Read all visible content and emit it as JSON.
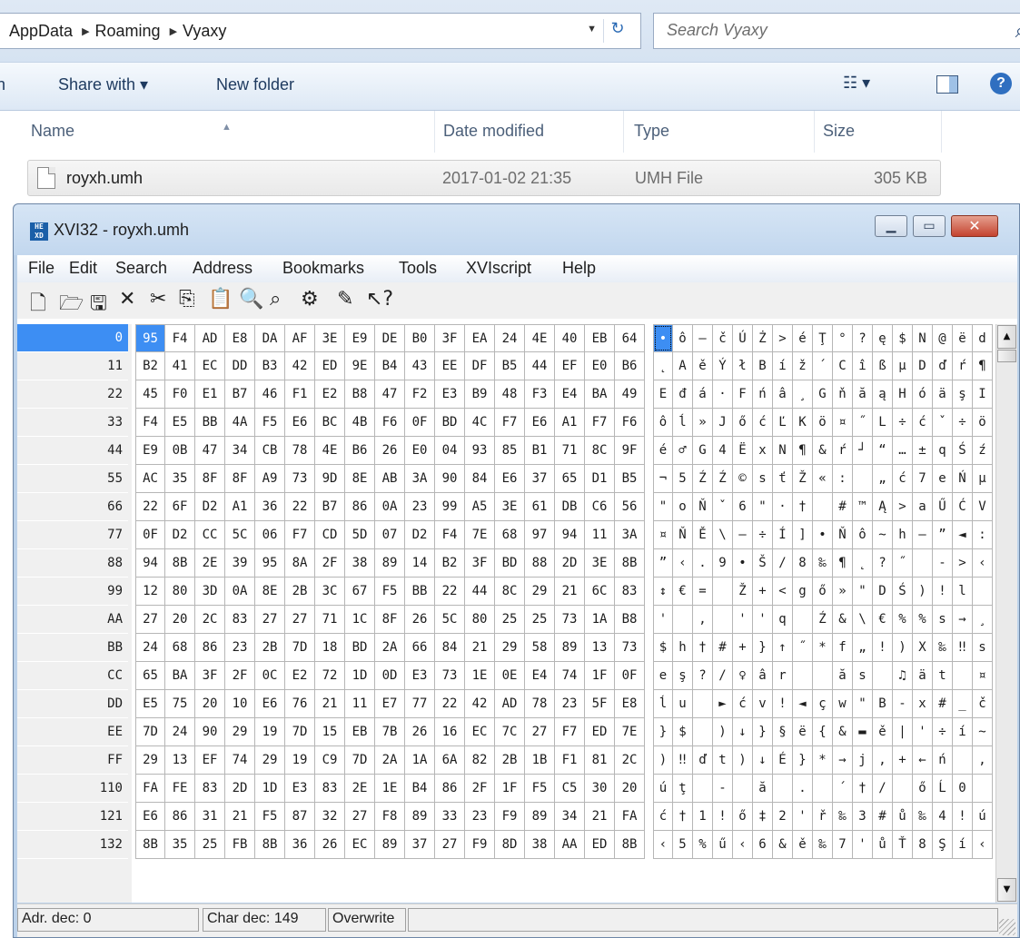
{
  "explorer": {
    "breadcrumb": [
      "AppData",
      "Roaming",
      "Vyaxy"
    ],
    "search_placeholder": "Search Vyaxy",
    "commands": {
      "left_fragment": "n",
      "share_with": "Share with ▾",
      "new_folder": "New folder"
    },
    "columns": [
      "Name",
      "Date modified",
      "Type",
      "Size"
    ],
    "file": {
      "name": "royxh.umh",
      "date": "2017-01-02 21:35",
      "type": "UMH File",
      "size": "305 KB"
    }
  },
  "xvi": {
    "title": "XVI32 - royxh.umh",
    "menu": [
      "File",
      "Edit",
      "Search",
      "Address",
      "Bookmarks",
      "Tools",
      "XVIscript",
      "Help"
    ],
    "toolbar_icons": [
      "new-file-icon",
      "open-icon",
      "save-icon",
      "close-x-icon",
      "cut-icon",
      "copy-icon",
      "paste-icon",
      "find-icon",
      "replace-icon",
      "properties-icon",
      "script-icon",
      "context-help-icon"
    ],
    "selected_row": 0,
    "rows": [
      {
        "addr": "0",
        "hex": [
          "95",
          "F4",
          "AD",
          "E8",
          "DA",
          "AF",
          "3E",
          "E9",
          "DE",
          "B0",
          "3F",
          "EA",
          "24",
          "4E",
          "40",
          "EB",
          "64"
        ],
        "chars": [
          "•",
          "ô",
          "–",
          "č",
          "Ú",
          "Ż",
          ">",
          "é",
          "Ţ",
          "°",
          "?",
          "ę",
          "$",
          "N",
          "@",
          "ë",
          "d"
        ]
      },
      {
        "addr": "11",
        "hex": [
          "B2",
          "41",
          "EC",
          "DD",
          "B3",
          "42",
          "ED",
          "9E",
          "B4",
          "43",
          "EE",
          "DF",
          "B5",
          "44",
          "EF",
          "E0",
          "B6"
        ],
        "chars": [
          "˛",
          "A",
          "ě",
          "Ý",
          "ł",
          "B",
          "í",
          "ž",
          "´",
          "C",
          "î",
          "ß",
          "µ",
          "D",
          "ď",
          "ŕ",
          "¶"
        ]
      },
      {
        "addr": "22",
        "hex": [
          "45",
          "F0",
          "E1",
          "B7",
          "46",
          "F1",
          "E2",
          "B8",
          "47",
          "F2",
          "E3",
          "B9",
          "48",
          "F3",
          "E4",
          "BA",
          "49"
        ],
        "chars": [
          "E",
          "đ",
          "á",
          "·",
          "F",
          "ń",
          "â",
          "¸",
          "G",
          "ň",
          "ă",
          "ą",
          "H",
          "ó",
          "ä",
          "ş",
          "I"
        ]
      },
      {
        "addr": "33",
        "hex": [
          "F4",
          "E5",
          "BB",
          "4A",
          "F5",
          "E6",
          "BC",
          "4B",
          "F6",
          "0F",
          "BD",
          "4C",
          "F7",
          "E6",
          "A1",
          "F7",
          "F6"
        ],
        "chars": [
          "ô",
          "ĺ",
          "»",
          "J",
          "ő",
          "ć",
          "Ľ",
          "K",
          "ö",
          "¤",
          "˝",
          "L",
          "÷",
          "ć",
          "ˇ",
          "÷",
          "ö"
        ]
      },
      {
        "addr": "44",
        "hex": [
          "E9",
          "0B",
          "47",
          "34",
          "CB",
          "78",
          "4E",
          "B6",
          "26",
          "E0",
          "04",
          "93",
          "85",
          "B1",
          "71",
          "8C",
          "9F"
        ],
        "chars": [
          "é",
          "♂",
          "G",
          "4",
          "Ë",
          "x",
          "N",
          "¶",
          "&",
          "ŕ",
          "┘",
          "“",
          "…",
          "±",
          "q",
          "Ś",
          "ź"
        ]
      },
      {
        "addr": "55",
        "hex": [
          "AC",
          "35",
          "8F",
          "8F",
          "A9",
          "73",
          "9D",
          "8E",
          "AB",
          "3A",
          "90",
          "84",
          "E6",
          "37",
          "65",
          "D1",
          "B5"
        ],
        "chars": [
          "¬",
          "5",
          "Ź",
          "Ź",
          "©",
          "s",
          "ť",
          "Ž",
          "«",
          ":",
          "",
          "„",
          "ć",
          "7",
          "e",
          "Ń",
          "µ"
        ]
      },
      {
        "addr": "66",
        "hex": [
          "22",
          "6F",
          "D2",
          "A1",
          "36",
          "22",
          "B7",
          "86",
          "0A",
          "23",
          "99",
          "A5",
          "3E",
          "61",
          "DB",
          "C6",
          "56"
        ],
        "chars": [
          "\"",
          "o",
          "Ň",
          "ˇ",
          "6",
          "\"",
          "·",
          "†",
          "",
          "#",
          "™",
          "Ą",
          ">",
          "a",
          "Ű",
          "Ć",
          "V"
        ]
      },
      {
        "addr": "77",
        "hex": [
          "0F",
          "D2",
          "CC",
          "5C",
          "06",
          "F7",
          "CD",
          "5D",
          "07",
          "D2",
          "F4",
          "7E",
          "68",
          "97",
          "94",
          "11",
          "3A"
        ],
        "chars": [
          "¤",
          "Ň",
          "Ě",
          "\\",
          "–",
          "÷",
          "Í",
          "]",
          "•",
          "Ň",
          "ô",
          "~",
          "h",
          "—",
          "”",
          "◄",
          ":"
        ]
      },
      {
        "addr": "88",
        "hex": [
          "94",
          "8B",
          "2E",
          "39",
          "95",
          "8A",
          "2F",
          "38",
          "89",
          "14",
          "B2",
          "3F",
          "BD",
          "88",
          "2D",
          "3E",
          "8B"
        ],
        "chars": [
          "”",
          "‹",
          ".",
          "9",
          "•",
          "Š",
          "/",
          "8",
          "‰",
          "¶",
          "˛",
          "?",
          "˝",
          "",
          "-",
          ">",
          "‹"
        ]
      },
      {
        "addr": "99",
        "hex": [
          "12",
          "80",
          "3D",
          "0A",
          "8E",
          "2B",
          "3C",
          "67",
          "F5",
          "BB",
          "22",
          "44",
          "8C",
          "29",
          "21",
          "6C",
          "83"
        ],
        "chars": [
          "↕",
          "€",
          "=",
          "",
          "Ž",
          "+",
          "<",
          "g",
          "ő",
          "»",
          "\"",
          "D",
          "Ś",
          ")",
          "!",
          "l",
          ""
        ]
      },
      {
        "addr": "AA",
        "hex": [
          "27",
          "20",
          "2C",
          "83",
          "27",
          "27",
          "71",
          "1C",
          "8F",
          "26",
          "5C",
          "80",
          "25",
          "25",
          "73",
          "1A",
          "B8"
        ],
        "chars": [
          "'",
          "",
          ",",
          "",
          "'",
          "'",
          "q",
          "",
          "Ź",
          "&",
          "\\",
          "€",
          "%",
          "%",
          "s",
          "→",
          "¸"
        ]
      },
      {
        "addr": "BB",
        "hex": [
          "24",
          "68",
          "86",
          "23",
          "2B",
          "7D",
          "18",
          "BD",
          "2A",
          "66",
          "84",
          "21",
          "29",
          "58",
          "89",
          "13",
          "73"
        ],
        "chars": [
          "$",
          "h",
          "†",
          "#",
          "+",
          "}",
          "↑",
          "˝",
          "*",
          "f",
          "„",
          "!",
          ")",
          "X",
          "‰",
          "‼",
          "s"
        ]
      },
      {
        "addr": "CC",
        "hex": [
          "65",
          "BA",
          "3F",
          "2F",
          "0C",
          "E2",
          "72",
          "1D",
          "0D",
          "E3",
          "73",
          "1E",
          "0E",
          "E4",
          "74",
          "1F",
          "0F"
        ],
        "chars": [
          "e",
          "ş",
          "?",
          "/",
          "♀",
          "â",
          "r",
          "",
          "",
          "ă",
          "s",
          "",
          "♫",
          "ä",
          "t",
          "",
          "¤"
        ]
      },
      {
        "addr": "DD",
        "hex": [
          "E5",
          "75",
          "20",
          "10",
          "E6",
          "76",
          "21",
          "11",
          "E7",
          "77",
          "22",
          "42",
          "AD",
          "78",
          "23",
          "5F",
          "E8"
        ],
        "chars": [
          "ĺ",
          "u",
          "",
          "►",
          "ć",
          "v",
          "!",
          "◄",
          "ç",
          "w",
          "\"",
          "B",
          "-",
          "x",
          "#",
          "_",
          "č"
        ]
      },
      {
        "addr": "EE",
        "hex": [
          "7D",
          "24",
          "90",
          "29",
          "19",
          "7D",
          "15",
          "EB",
          "7B",
          "26",
          "16",
          "EC",
          "7C",
          "27",
          "F7",
          "ED",
          "7E"
        ],
        "chars": [
          "}",
          "$",
          "",
          ")",
          "↓",
          "}",
          "§",
          "ë",
          "{",
          "&",
          "▬",
          "ě",
          "|",
          "'",
          "÷",
          "í",
          "~"
        ]
      },
      {
        "addr": "FF",
        "hex": [
          "29",
          "13",
          "EF",
          "74",
          "29",
          "19",
          "C9",
          "7D",
          "2A",
          "1A",
          "6A",
          "82",
          "2B",
          "1B",
          "F1",
          "81",
          "2C"
        ],
        "chars": [
          ")",
          "‼",
          "ď",
          "t",
          ")",
          "↓",
          "É",
          "}",
          "*",
          "→",
          "j",
          "‚",
          "+",
          "←",
          "ń",
          "",
          ","
        ]
      },
      {
        "addr": "110",
        "hex": [
          "FA",
          "FE",
          "83",
          "2D",
          "1D",
          "E3",
          "83",
          "2E",
          "1E",
          "B4",
          "86",
          "2F",
          "1F",
          "F5",
          "C5",
          "30",
          "20"
        ],
        "chars": [
          "ú",
          "ţ",
          "",
          "-",
          "",
          "ă",
          "",
          ".",
          "",
          "´",
          "†",
          "/",
          "",
          "ő",
          "Ĺ",
          "0",
          ""
        ]
      },
      {
        "addr": "121",
        "hex": [
          "E6",
          "86",
          "31",
          "21",
          "F5",
          "87",
          "32",
          "27",
          "F8",
          "89",
          "33",
          "23",
          "F9",
          "89",
          "34",
          "21",
          "FA"
        ],
        "chars": [
          "ć",
          "†",
          "1",
          "!",
          "ő",
          "‡",
          "2",
          "'",
          "ř",
          "‰",
          "3",
          "#",
          "ů",
          "‰",
          "4",
          "!",
          "ú"
        ]
      },
      {
        "addr": "132",
        "hex": [
          "8B",
          "35",
          "25",
          "FB",
          "8B",
          "36",
          "26",
          "EC",
          "89",
          "37",
          "27",
          "F9",
          "8D",
          "38",
          "AA",
          "ED",
          "8B"
        ],
        "chars": [
          "‹",
          "5",
          "%",
          "ű",
          "‹",
          "6",
          "&",
          "ě",
          "‰",
          "7",
          "'",
          "ů",
          "Ť",
          "8",
          "Ş",
          "í",
          "‹"
        ]
      }
    ],
    "status": {
      "addr": "Adr. dec: 0",
      "char": "Char dec: 149",
      "mode": "Overwrite"
    }
  }
}
